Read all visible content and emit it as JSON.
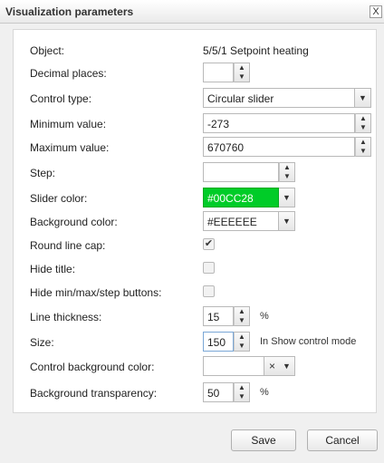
{
  "dialog": {
    "title": "Visualization parameters",
    "close_glyph": "X"
  },
  "fields": {
    "object": {
      "label": "Object:",
      "value": "5/5/1 Setpoint heating"
    },
    "decimal_places": {
      "label": "Decimal places:",
      "value": ""
    },
    "control_type": {
      "label": "Control type:",
      "value": "Circular slider"
    },
    "minimum_value": {
      "label": "Minimum value:",
      "value": "-273"
    },
    "maximum_value": {
      "label": "Maximum value:",
      "value": "670760"
    },
    "step": {
      "label": "Step:",
      "value": ""
    },
    "slider_color": {
      "label": "Slider color:",
      "value": "#00CC28",
      "swatch": "#00cc28"
    },
    "background_color": {
      "label": "Background color:",
      "value": "#EEEEEE",
      "swatch": "#ffffff"
    },
    "round_line_cap": {
      "label": "Round line cap:",
      "checked": true
    },
    "hide_title": {
      "label": "Hide title:",
      "checked": false
    },
    "hide_buttons": {
      "label": "Hide min/max/step buttons:",
      "checked": false
    },
    "line_thickness": {
      "label": "Line thickness:",
      "value": "15",
      "unit": "%"
    },
    "size": {
      "label": "Size:",
      "value": "150",
      "note": "In Show control mode"
    },
    "control_background_color": {
      "label": "Control background color:",
      "value": ""
    },
    "background_transparency": {
      "label": "Background transparency:",
      "value": "50",
      "unit": "%"
    }
  },
  "icons": {
    "spin_up": "▲",
    "spin_down": "▼",
    "dropdown": "▼",
    "check": "✔",
    "clear": "×"
  },
  "buttons": {
    "save": "Save",
    "cancel": "Cancel"
  }
}
